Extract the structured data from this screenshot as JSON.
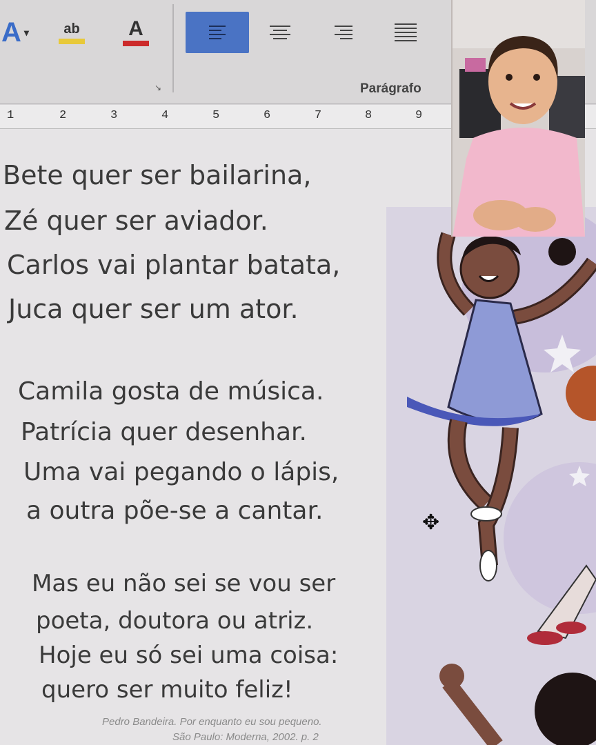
{
  "ribbon": {
    "font_color_glyph": "A",
    "highlight_glyph": "ab",
    "text_color_glyph": "A",
    "dropdown_glyph": "▾",
    "group_label": "Parágrafo",
    "launcher_glyph": "↘"
  },
  "ruler": {
    "ticks": [
      "1",
      "2",
      "3",
      "4",
      "5",
      "6",
      "7",
      "8",
      "9"
    ]
  },
  "poem": {
    "stanza1": [
      "Bete quer ser bailarina,",
      "Zé quer ser aviador.",
      "Carlos vai plantar batata,",
      "Juca quer ser um ator."
    ],
    "stanza2": [
      "Camila gosta de música.",
      "Patrícia quer desenhar.",
      "Uma vai pegando o lápis,",
      "a outra põe-se a cantar."
    ],
    "stanza3": [
      "Mas eu não sei se vou ser",
      "poeta, doutora ou atriz.",
      "Hoje eu só sei uma coisa:",
      "quero ser muito feliz!"
    ],
    "credit_line1": "Pedro Bandeira. Por enquanto eu sou pequeno.",
    "credit_line2": "São Paulo: Moderna, 2002. p. 2"
  },
  "colors": {
    "accent": "#4a73c4",
    "highlight": "#e8c93a",
    "text_red": "#cc2a2a",
    "dress": "#8e9ad6"
  },
  "icons": {
    "cursor": "move-cursor-icon"
  }
}
